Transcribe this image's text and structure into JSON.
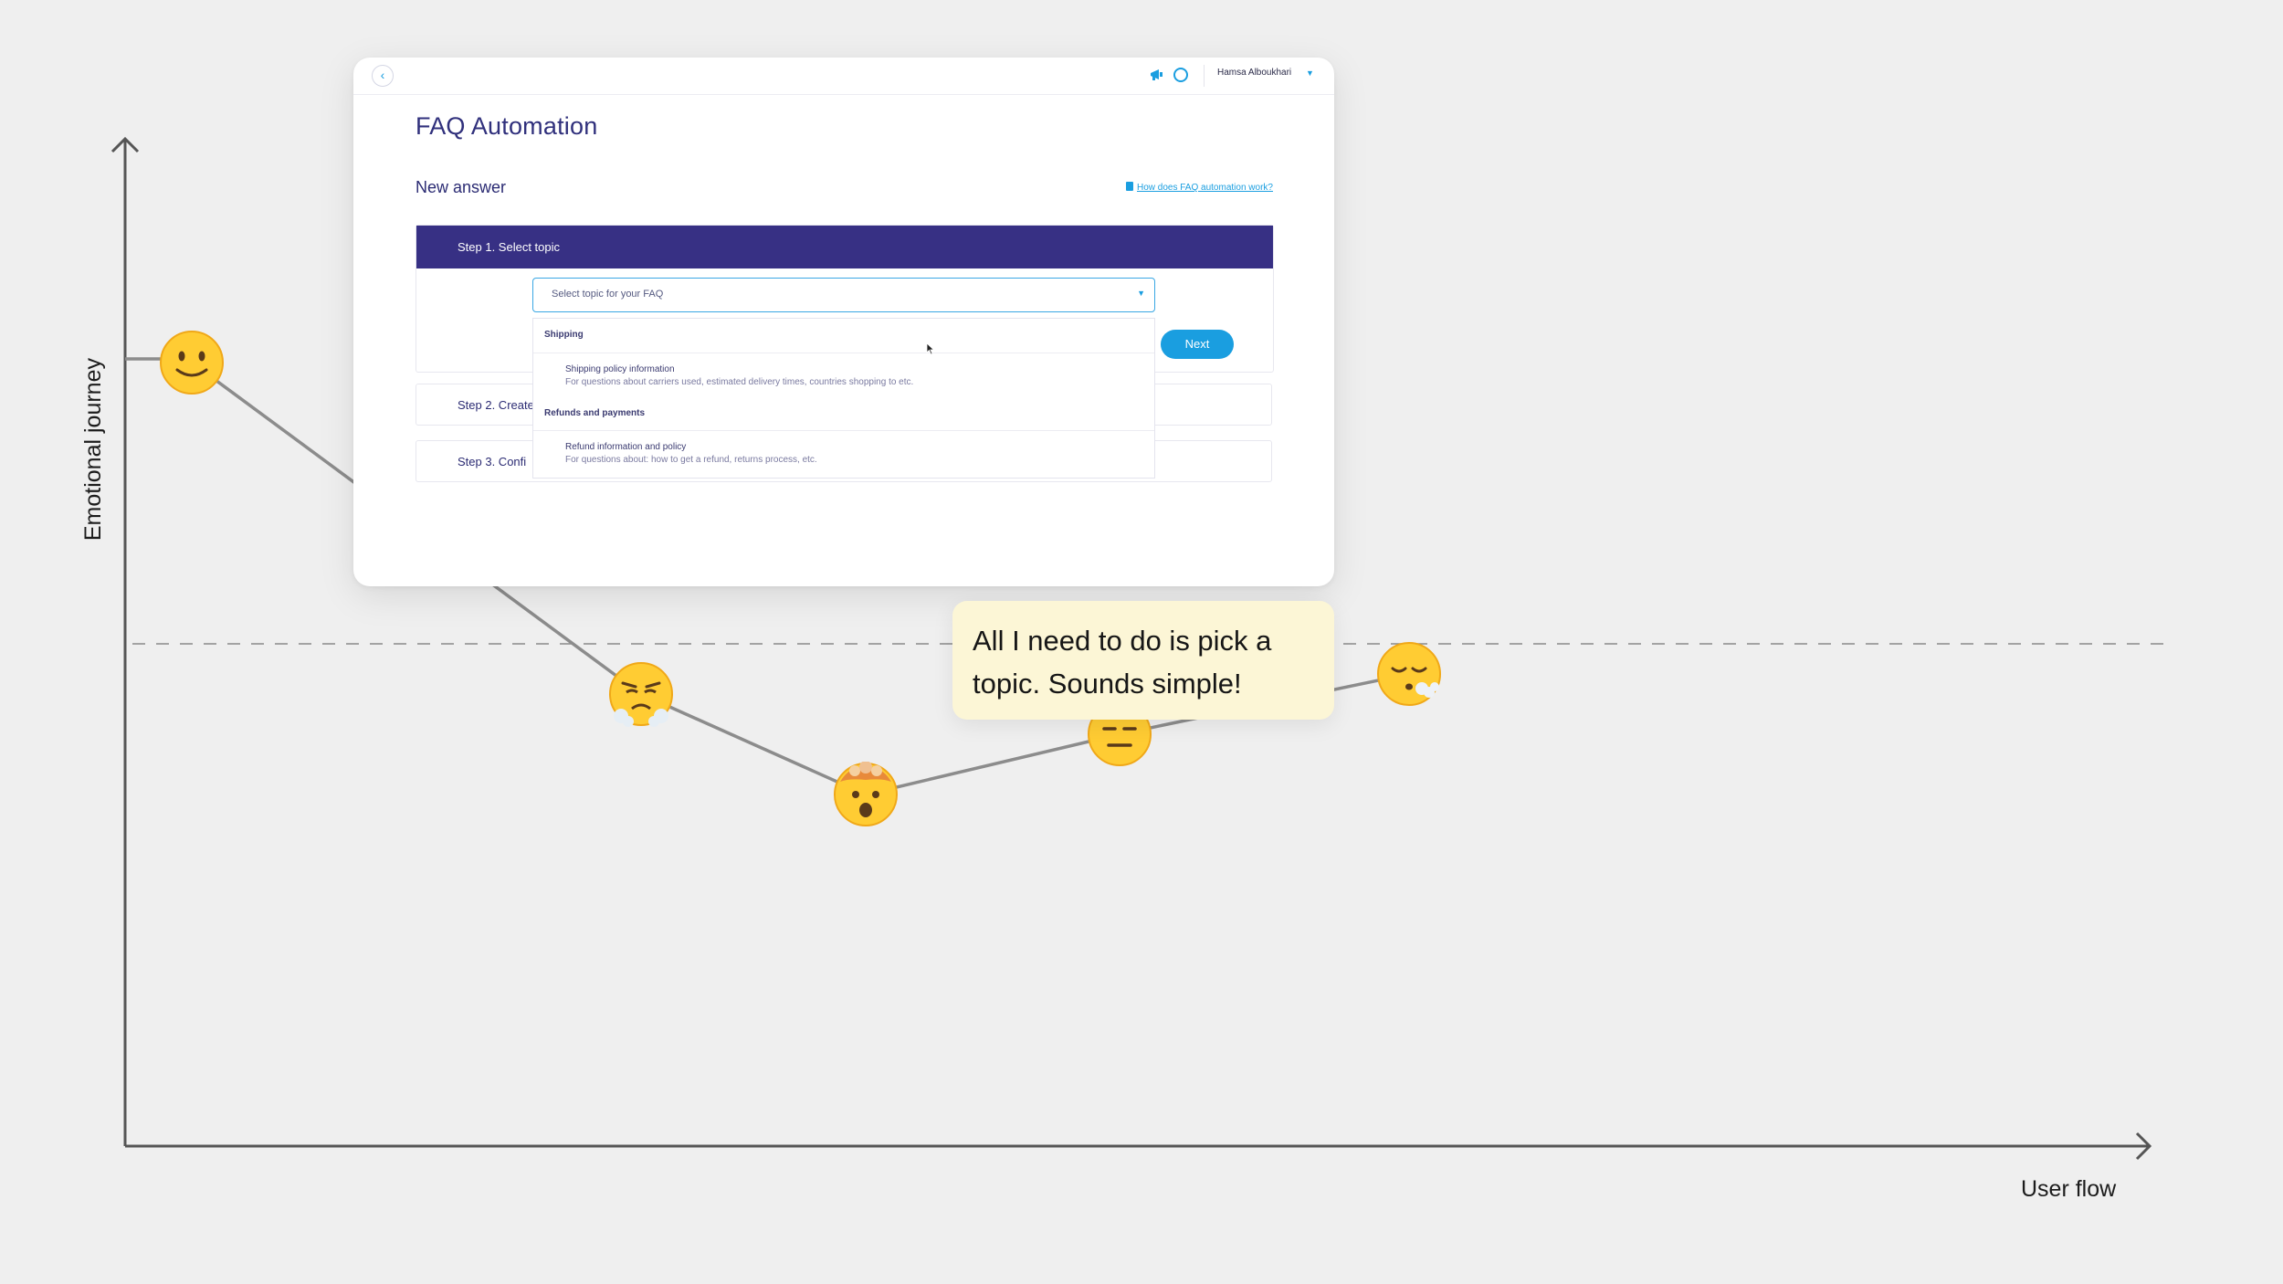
{
  "axes": {
    "y_label": "Emotional journey",
    "x_label": "User flow"
  },
  "journey": {
    "points": [
      {
        "x": 0,
        "y": 0.78,
        "emoji": "🙂",
        "icon": "slightly-smiling-face-icon"
      },
      {
        "x": 1,
        "y": 0.45,
        "emoji": "😤",
        "icon": "steaming-face-icon"
      },
      {
        "x": 2,
        "y": 0.35,
        "emoji": "🤯",
        "icon": "exploding-head-icon"
      },
      {
        "x": 3,
        "y": 0.41,
        "emoji": "😑",
        "icon": "expressionless-face-icon"
      },
      {
        "x": 4,
        "y": 0.47,
        "emoji": "😮‍💨",
        "icon": "exhaling-face-icon"
      }
    ],
    "baseline": 0.5,
    "line_color": "#8c8c8c",
    "axis_color": "#555555"
  },
  "app": {
    "username": "Hamsa Alboukhari",
    "page_title": "FAQ Automation",
    "subtitle": "New answer",
    "help_link": "How does FAQ automation work?",
    "accent_color": "#1a9ee0",
    "header_color": "#373084",
    "steps": {
      "step1": "Step 1. Select topic",
      "step2": "Step 2. Create",
      "step3": "Step 3. Confi"
    },
    "select_placeholder": "Select topic for your FAQ",
    "next_button": "Next",
    "dropdown": {
      "group1": "Shipping",
      "option1_title": "Shipping policy information",
      "option1_desc": "For questions about carriers used, estimated delivery times, countries shopping to etc.",
      "group2": "Refunds and payments",
      "option2_title": "Refund information and policy",
      "option2_desc": "For questions about: how to get a refund, returns process, etc."
    }
  },
  "callout": {
    "text": "All I need to do is pick a topic. Sounds simple!",
    "background": "#fcf6d6"
  }
}
